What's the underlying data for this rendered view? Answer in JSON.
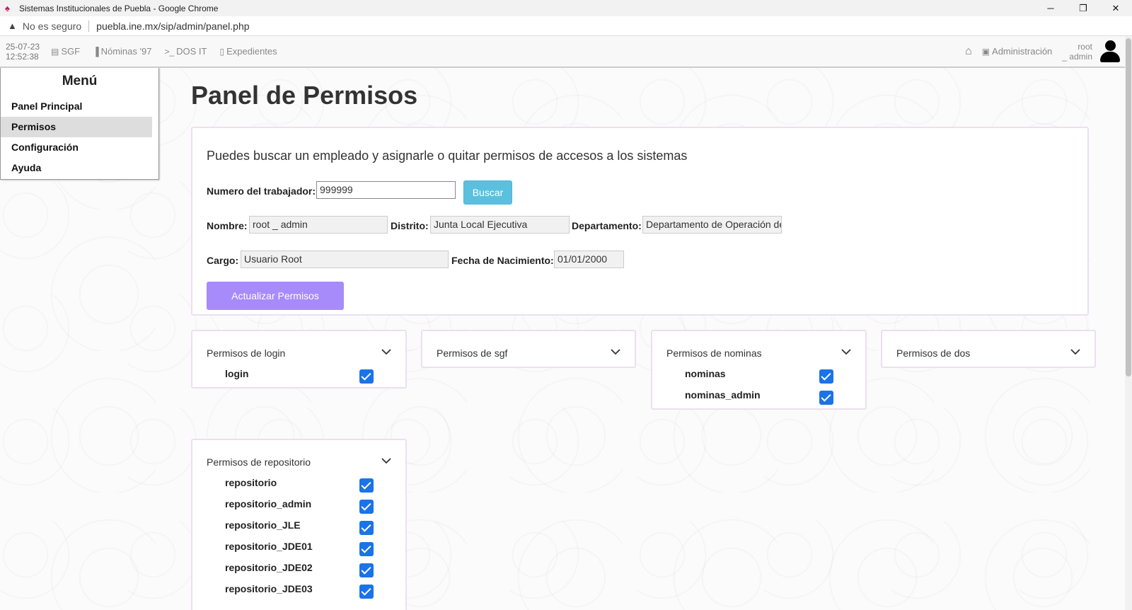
{
  "browser": {
    "window_title": "Sistemas Institucionales de Puebla - Google Chrome",
    "security_label": "No es seguro",
    "url": "puebla.ine.mx/sip/admin/panel.php"
  },
  "navbar": {
    "date": "25-07-23",
    "time": "12:52:38",
    "links": [
      "SGF",
      "Nóminas '97",
      "DOS IT",
      "Expedientes"
    ],
    "admin_label": "Administración",
    "user_line1": "root",
    "user_line2": "_ admin"
  },
  "sidebar": {
    "title": "Menú",
    "items": [
      "Panel Principal",
      "Permisos",
      "Configuración",
      "Ayuda"
    ],
    "active": "Permisos"
  },
  "main": {
    "title": "Panel de Permisos",
    "intro": "Puedes buscar un empleado y asignarle o quitar permisos de accesos a los sistemas",
    "labels": {
      "numero": "Numero del trabajador:",
      "nombre": "Nombre:",
      "distrito": "Distrito:",
      "departamento": "Departamento:",
      "cargo": "Cargo:",
      "fecha": "Fecha de Nacimiento:"
    },
    "values": {
      "numero": "999999",
      "nombre": "root _ admin",
      "distrito": "Junta Local Ejecutiva",
      "departamento": "Departamento de Operación de",
      "cargo": "Usuario Root",
      "fecha": "01/01/2000"
    },
    "buscar_label": "Buscar",
    "actualizar_label": "Actualizar Permisos"
  },
  "permissions": {
    "login": {
      "title": "Permisos de login",
      "items": [
        "login"
      ]
    },
    "sgf": {
      "title": "Permisos de sgf",
      "items": []
    },
    "nominas": {
      "title": "Permisos de nominas",
      "items": [
        "nominas",
        "nominas_admin"
      ]
    },
    "dos": {
      "title": "Permisos de dos",
      "items": []
    },
    "repositorio": {
      "title": "Permisos de repositorio",
      "items": [
        "repositorio",
        "repositorio_admin",
        "repositorio_JLE",
        "repositorio_JDE01",
        "repositorio_JDE02",
        "repositorio_JDE03"
      ]
    }
  },
  "colors": {
    "buscar": "#5bc0de",
    "actualizar": "#a78bfa",
    "checkbox": "#1a73e8",
    "card_border": "#ecdff0"
  }
}
